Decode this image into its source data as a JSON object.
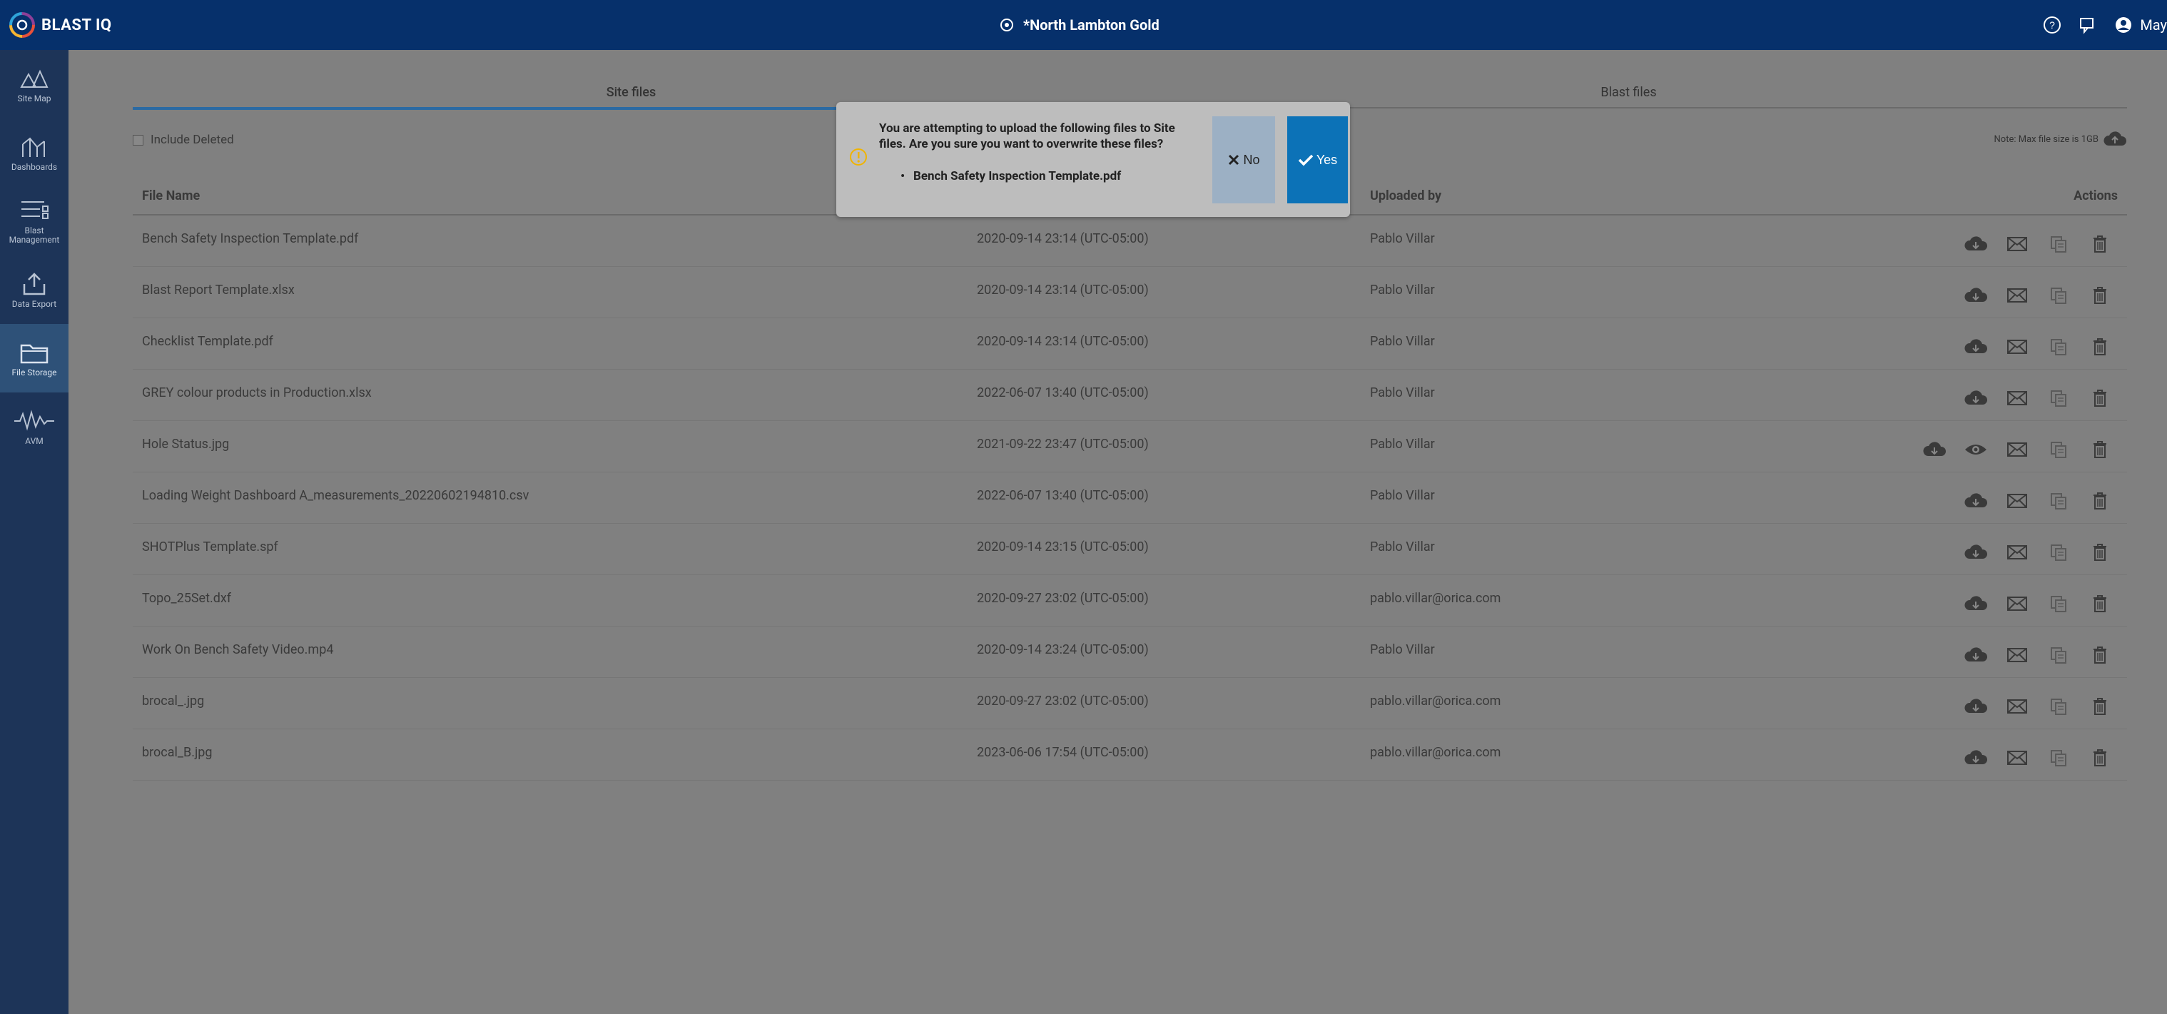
{
  "app": {
    "logo_text": "BLAST IQ",
    "site_title": "*North Lambton Gold",
    "user_name": "May"
  },
  "sidebar": {
    "items": [
      {
        "label": "Site Map",
        "icon": "map-icon"
      },
      {
        "label": "Dashboards",
        "icon": "chart-icon"
      },
      {
        "label": "Blast Management",
        "icon": "list-icon"
      },
      {
        "label": "Data Export",
        "icon": "export-icon"
      },
      {
        "label": "File Storage",
        "icon": "folder-icon",
        "active": true
      },
      {
        "label": "AVM",
        "icon": "waveform-icon"
      }
    ]
  },
  "tabs": [
    {
      "label": "Site files",
      "active": true
    },
    {
      "label": "Blast files",
      "active": false
    }
  ],
  "include_deleted_label": "Include Deleted",
  "note": "Note: Max file size is 1GB",
  "table": {
    "headers": {
      "name": "File Name",
      "uploaded_by": "Uploaded by",
      "actions": "Actions"
    },
    "rows": [
      {
        "name": "Bench Safety Inspection Template.pdf",
        "date": "2020-09-14 23:14 (UTC-05:00)",
        "user": "Pablo Villar"
      },
      {
        "name": "Blast Report Template.xlsx",
        "date": "2020-09-14 23:14 (UTC-05:00)",
        "user": "Pablo Villar"
      },
      {
        "name": "Checklist Template.pdf",
        "date": "2020-09-14 23:14 (UTC-05:00)",
        "user": "Pablo Villar"
      },
      {
        "name": "GREY colour products in Production.xlsx",
        "date": "2022-06-07 13:40 (UTC-05:00)",
        "user": "Pablo Villar"
      },
      {
        "name": "Hole Status.jpg",
        "date": "2021-09-22 23:47 (UTC-05:00)",
        "user": "Pablo Villar",
        "has_preview": true
      },
      {
        "name": "Loading Weight Dashboard A_measurements_20220602194810.csv",
        "date": "2022-06-07 13:40 (UTC-05:00)",
        "user": "Pablo Villar"
      },
      {
        "name": "SHOTPlus Template.spf",
        "date": "2020-09-14 23:15 (UTC-05:00)",
        "user": "Pablo Villar"
      },
      {
        "name": "Topo_25Set.dxf",
        "date": "2020-09-27 23:02 (UTC-05:00)",
        "user": "pablo.villar@orica.com"
      },
      {
        "name": "Work On Bench Safety Video.mp4",
        "date": "2020-09-14 23:24 (UTC-05:00)",
        "user": "Pablo Villar"
      },
      {
        "name": "brocal_.jpg",
        "date": "2020-09-27 23:02 (UTC-05:00)",
        "user": "pablo.villar@orica.com"
      },
      {
        "name": "brocal_B.jpg",
        "date": "2023-06-06 17:54 (UTC-05:00)",
        "user": "pablo.villar@orica.com"
      }
    ]
  },
  "modal": {
    "message": "You are attempting to upload the following files to Site files. Are you sure you want to overwrite these files?",
    "file": "Bench Safety Inspection Template.pdf",
    "no_label": "No",
    "yes_label": "Yes"
  },
  "colors": {
    "topbar": "#06306b",
    "sidebar": "#1d3458",
    "yes_button": "#0c72b7",
    "no_button": "#9cb0c4",
    "warning": "#f0b400"
  }
}
